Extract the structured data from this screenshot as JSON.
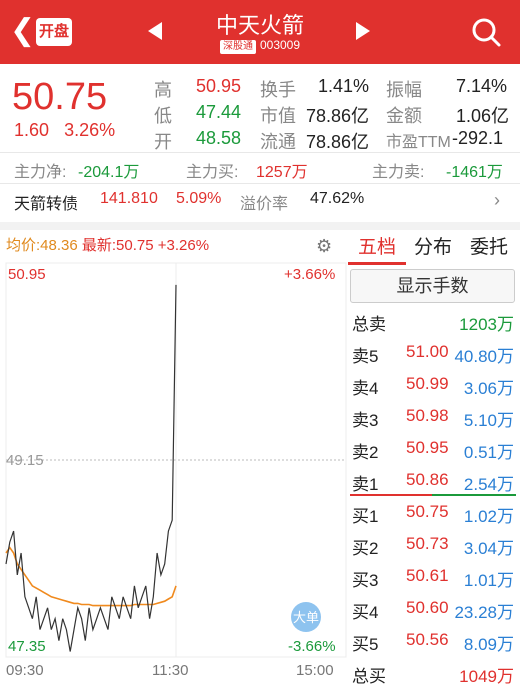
{
  "header": {
    "back_icon": "chevron-left-icon",
    "open_label": "开盘",
    "stock_name": "中天火箭",
    "exchange_badge": "深股通",
    "stock_code": "003009",
    "search_icon": "search-icon"
  },
  "quote": {
    "price": "50.75",
    "change": "1.60",
    "change_pct": "3.26%",
    "high_label": "高",
    "high": "50.95",
    "low_label": "低",
    "low": "47.44",
    "open_label": "开",
    "open": "48.58",
    "turnover_label": "换手",
    "turnover": "1.41%",
    "mktcap_label": "市值",
    "mktcap": "78.86亿",
    "float_label": "流通",
    "float": "78.86亿",
    "amplitude_label": "振幅",
    "amplitude": "7.14%",
    "amount_label": "金额",
    "amount": "1.06亿",
    "pe_label": "市盈TTM",
    "pe": "-292.1"
  },
  "flow": {
    "net_label": "主力净:",
    "net": "-204.1万",
    "buy_label": "主力买:",
    "buy": "1257万",
    "sell_label": "主力卖:",
    "sell": "-1461万"
  },
  "bond": {
    "name": "天箭转债",
    "price": "141.810",
    "pct": "5.09%",
    "premium_label": "溢价率",
    "premium": "47.62%"
  },
  "chart_header": {
    "avg_label": "均价:48.36",
    "latest_label": "最新:50.75 +3.26%"
  },
  "chart_data": {
    "type": "line",
    "y_max_label": "50.95",
    "y_max_pct": "+3.66%",
    "y_mid_label": "49.15",
    "y_min_label": "47.35",
    "y_min_pct": "-3.66%",
    "x_labels": [
      "09:30",
      "11:30",
      "15:00"
    ],
    "ylim": [
      47.35,
      50.95
    ],
    "big_order_badge": "大单",
    "series": [
      {
        "name": "最新",
        "values": [
          48.2,
          48.4,
          48.5,
          48.1,
          48.3,
          47.9,
          47.8,
          47.7,
          47.9,
          47.6,
          47.7,
          47.8,
          47.6,
          47.7,
          47.5,
          47.7,
          47.6,
          47.4,
          47.6,
          47.8,
          47.7,
          47.5,
          47.8,
          47.6,
          47.7,
          47.8,
          47.7,
          47.6,
          47.9,
          47.8,
          47.7,
          47.9,
          47.8,
          47.7,
          48.0,
          47.8,
          47.9,
          48.0,
          47.7,
          47.9,
          48.3,
          48.1,
          48.2,
          48.5,
          48.6,
          50.75
        ]
      },
      {
        "name": "均价",
        "values": [
          48.3,
          48.35,
          48.3,
          48.2,
          48.15,
          48.1,
          48.05,
          48.0,
          47.98,
          47.96,
          47.94,
          47.92,
          47.9,
          47.89,
          47.88,
          47.87,
          47.86,
          47.85,
          47.84,
          47.84,
          47.83,
          47.83,
          47.83,
          47.82,
          47.82,
          47.82,
          47.82,
          47.82,
          47.82,
          47.82,
          47.82,
          47.82,
          47.82,
          47.82,
          47.83,
          47.83,
          47.83,
          47.83,
          47.83,
          47.83,
          47.84,
          47.85,
          47.86,
          47.88,
          47.9,
          48.0
        ]
      }
    ]
  },
  "depth": {
    "tabs": [
      "五档",
      "分布",
      "委托"
    ],
    "show_hands_label": "显示手数",
    "total_sell_label": "总卖",
    "total_sell": "1203万",
    "asks": [
      {
        "label": "卖5",
        "price": "51.00",
        "vol": "40.80万"
      },
      {
        "label": "卖4",
        "price": "50.99",
        "vol": "3.06万"
      },
      {
        "label": "卖3",
        "price": "50.98",
        "vol": "5.10万"
      },
      {
        "label": "卖2",
        "price": "50.95",
        "vol": "0.51万"
      },
      {
        "label": "卖1",
        "price": "50.86",
        "vol": "2.54万"
      }
    ],
    "bids": [
      {
        "label": "买1",
        "price": "50.75",
        "vol": "1.02万"
      },
      {
        "label": "买2",
        "price": "50.73",
        "vol": "3.04万"
      },
      {
        "label": "买3",
        "price": "50.61",
        "vol": "1.01万"
      },
      {
        "label": "买4",
        "price": "50.60",
        "vol": "23.28万"
      },
      {
        "label": "买5",
        "price": "50.56",
        "vol": "8.09万"
      }
    ],
    "total_buy_label": "总买",
    "total_buy": "1049万"
  },
  "colors": {
    "red": "#e0312e",
    "green": "#1b9a3b",
    "avg_line": "#f08a1e",
    "price_line": "#333333",
    "blue_vol": "#2a7fd4"
  }
}
